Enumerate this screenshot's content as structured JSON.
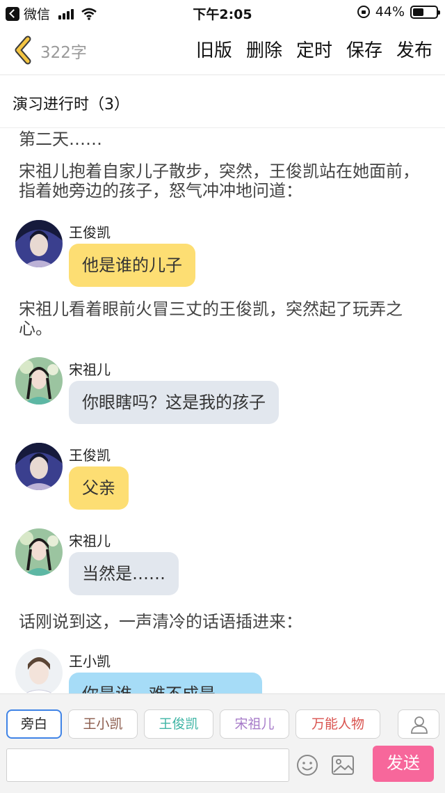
{
  "status_bar": {
    "back_app": "微信",
    "time": "下午2:05",
    "battery": "44%"
  },
  "nav": {
    "word_count": "322字",
    "actions": [
      "旧版",
      "删除",
      "定时",
      "保存",
      "发布"
    ]
  },
  "title": "演习进行时（3）",
  "story": {
    "narration_1": "第二天……",
    "narration_2": "宋祖儿抱着自家儿子散步，突然，王俊凯站在她面前，指着她旁边的孩子，怒气冲冲地问道：",
    "narration_3": "宋祖儿看着眼前火冒三丈的王俊凯，突然起了玩弄之心。",
    "narration_4": "话刚说到这，一声清冷的话语插进来：",
    "messages": [
      {
        "speaker": "王俊凯",
        "text": "他是谁的儿子",
        "color": "#fdde73"
      },
      {
        "speaker": "宋祖儿",
        "text": "你眼瞎吗？这是我的孩子",
        "color": "#e2e7ee"
      },
      {
        "speaker": "王俊凯",
        "text": "父亲",
        "color": "#fdde73"
      },
      {
        "speaker": "宋祖儿",
        "text": "当然是……",
        "color": "#e2e7ee"
      },
      {
        "speaker": "王小凯",
        "text": "你是谁，难不成是……",
        "color": "#a6dcf7"
      }
    ]
  },
  "characters": [
    {
      "label": "旁白",
      "color": "#222222"
    },
    {
      "label": "王小凯",
      "color": "#8a5a4a"
    },
    {
      "label": "王俊凯",
      "color": "#3fb5a5"
    },
    {
      "label": "宋祖儿",
      "color": "#a77cc9"
    },
    {
      "label": "万能人物",
      "color": "#d9534f"
    }
  ],
  "composer": {
    "input_value": "",
    "send_label": "发送"
  },
  "colors": {
    "accent": "#3f83e6",
    "send": "#f7679b",
    "back_chevron": "#f4c542"
  },
  "icons": [
    "back-chevron-icon",
    "emoji-icon",
    "image-icon",
    "person-icon",
    "wifi-icon",
    "battery-icon",
    "lock-rotation-icon"
  ]
}
